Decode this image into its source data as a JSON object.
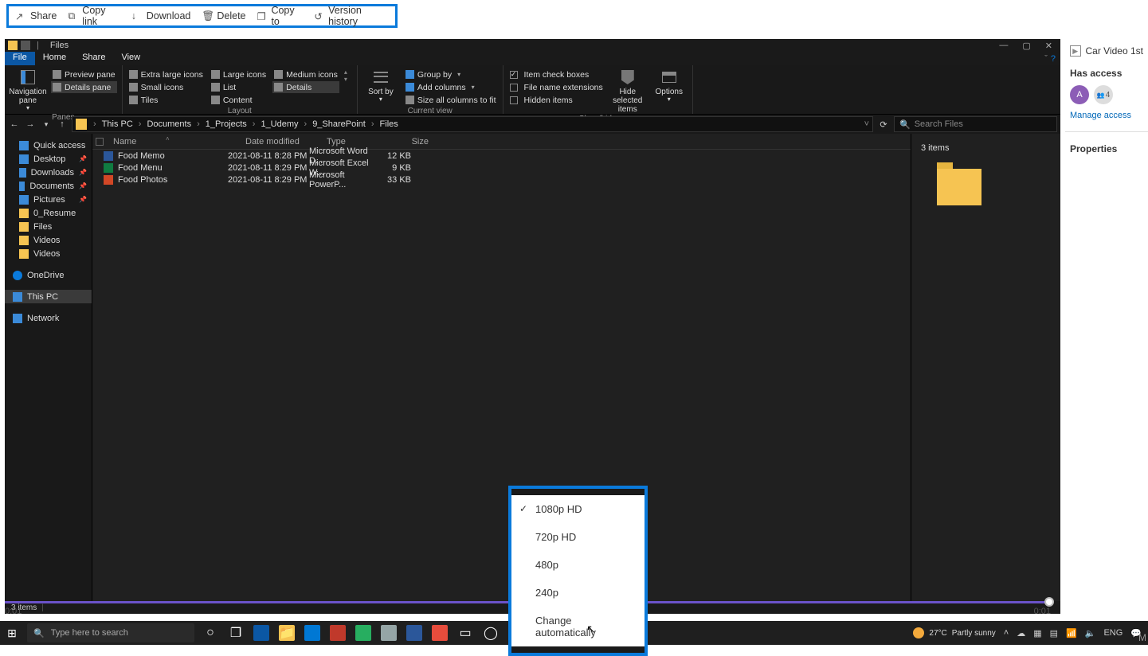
{
  "sp_toolbar": {
    "share": "Share",
    "copy_link": "Copy link",
    "download": "Download",
    "delete": "Delete",
    "copy_to": "Copy to",
    "version_history": "Version history"
  },
  "explorer": {
    "title": "Files",
    "tabs": {
      "file": "File",
      "home": "Home",
      "share": "Share",
      "view": "View"
    },
    "ribbon": {
      "panes": {
        "navigation_pane": "Navigation pane",
        "preview_pane": "Preview pane",
        "details_pane": "Details pane",
        "group_label": "Panes"
      },
      "layout": {
        "extra_large": "Extra large icons",
        "large": "Large icons",
        "medium": "Medium icons",
        "small": "Small icons",
        "list": "List",
        "details": "Details",
        "tiles": "Tiles",
        "content": "Content",
        "group_label": "Layout"
      },
      "current_view": {
        "sort_by": "Sort by",
        "group_by": "Group by",
        "add_columns": "Add columns",
        "size_all": "Size all columns to fit",
        "group_label": "Current view"
      },
      "show_hide": {
        "item_checkboxes": "Item check boxes",
        "file_ext": "File name extensions",
        "hidden_items": "Hidden items",
        "hide_selected": "Hide selected items",
        "options": "Options",
        "group_label": "Show/hide"
      }
    },
    "breadcrumb": [
      "This PC",
      "Documents",
      "1_Projects",
      "1_Udemy",
      "9_SharePoint",
      "Files"
    ],
    "search_placeholder": "Search Files",
    "columns": {
      "name": "Name",
      "date": "Date modified",
      "type": "Type",
      "size": "Size"
    },
    "files": [
      {
        "name": "Food Memo",
        "date": "2021-08-11 8:28 PM",
        "type": "Microsoft Word D...",
        "size": "12 KB",
        "kind": "word"
      },
      {
        "name": "Food Menu",
        "date": "2021-08-11 8:29 PM",
        "type": "Microsoft Excel W...",
        "size": "9 KB",
        "kind": "excel"
      },
      {
        "name": "Food Photos",
        "date": "2021-08-11 8:29 PM",
        "type": "Microsoft PowerP...",
        "size": "33 KB",
        "kind": "ppt"
      }
    ],
    "sidebar": {
      "quick_access": "Quick access",
      "desktop": "Desktop",
      "downloads": "Downloads",
      "documents": "Documents",
      "pictures": "Pictures",
      "resume": "0_Resume",
      "files": "Files",
      "videos1": "Videos",
      "videos2": "Videos",
      "onedrive": "OneDrive",
      "this_pc": "This PC",
      "network": "Network"
    },
    "preview_count": "3 items",
    "status": "3 items"
  },
  "sp_panel": {
    "title": "Car Video 1st",
    "has_access": "Has access",
    "avatar_initial": "A",
    "count": "4",
    "manage": "Manage access",
    "properties": "Properties"
  },
  "quality": {
    "q1": "1080p HD",
    "q2": "720p HD",
    "q3": "480p",
    "q4": "240p",
    "auto": "Change automatically"
  },
  "progress": {
    "left": "0:01",
    "right": "0:01"
  },
  "taskbar": {
    "search_placeholder": "Type here to search",
    "weather_temp": "27°C",
    "weather_text": "Partly sunny",
    "lang": "ENG"
  },
  "marker": "M"
}
